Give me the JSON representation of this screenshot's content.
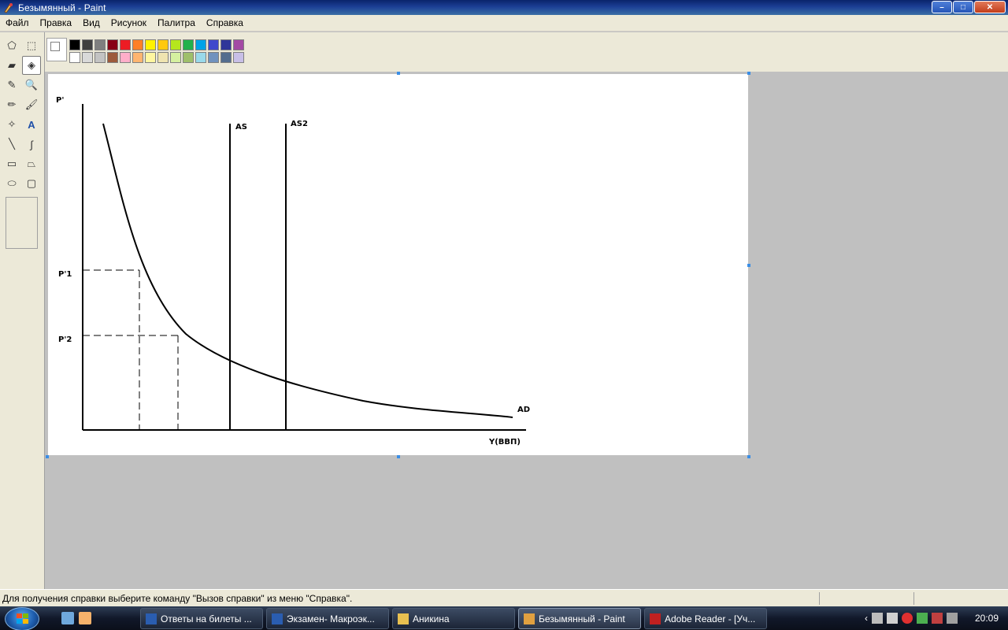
{
  "window": {
    "title": "Безымянный - Paint",
    "buttons": {
      "minimize": "–",
      "maximize": "□",
      "close": "✕"
    }
  },
  "menu": [
    "Файл",
    "Правка",
    "Вид",
    "Рисунок",
    "Палитра",
    "Справка"
  ],
  "tools": [
    {
      "name": "free-select-icon",
      "glyph": "⬠"
    },
    {
      "name": "rect-select-icon",
      "glyph": "⬚"
    },
    {
      "name": "eraser-icon",
      "glyph": "▰"
    },
    {
      "name": "fill-icon",
      "glyph": "◈",
      "selected": true
    },
    {
      "name": "color-picker-icon",
      "glyph": "✎"
    },
    {
      "name": "magnifier-icon",
      "glyph": "🔍"
    },
    {
      "name": "pencil-icon",
      "glyph": "✏"
    },
    {
      "name": "brush-icon",
      "glyph": "🖌"
    },
    {
      "name": "airbrush-icon",
      "glyph": "✧"
    },
    {
      "name": "text-icon",
      "glyph": "A"
    },
    {
      "name": "line-icon",
      "glyph": "╲"
    },
    {
      "name": "curve-icon",
      "glyph": "∫"
    },
    {
      "name": "rectangle-icon",
      "glyph": "▭"
    },
    {
      "name": "polygon-icon",
      "glyph": "⏢"
    },
    {
      "name": "ellipse-icon",
      "glyph": "⬭"
    },
    {
      "name": "rounded-rect-icon",
      "glyph": "▢"
    }
  ],
  "palette": {
    "top": [
      "#000000",
      "#3f3f3f",
      "#7f7f7f",
      "#880015",
      "#ed1c24",
      "#ff7f27",
      "#fff200",
      "#ffc90e",
      "#b5e61d",
      "#22b14c",
      "#00a2e8",
      "#3f48cc",
      "#2f3699",
      "#a349a4"
    ],
    "bottom": [
      "#ffffff",
      "#d9d9d9",
      "#c3c3c3",
      "#9c5a3c",
      "#ffaec9",
      "#ffb570",
      "#fff6a0",
      "#efe4b0",
      "#d5f0a0",
      "#9fbf6b",
      "#99d9ea",
      "#7092be",
      "#546d8e",
      "#c8bfe7"
    ]
  },
  "drawing": {
    "labels": {
      "y_axis": "P'",
      "p1": "P'1",
      "p2": "P'2",
      "as": "AS",
      "as2": "AS2",
      "ad": "AD",
      "x_axis": "Y(ВВП)"
    }
  },
  "status": {
    "help_text": "Для получения справки выберите команду \"Вызов справки\" из меню \"Справка\"."
  },
  "taskbar": {
    "tasks": [
      {
        "label": "Ответы на билеты ...",
        "icon": "word-icon",
        "active": false
      },
      {
        "label": "Экзамен- Макроэк...",
        "icon": "word-icon",
        "active": false
      },
      {
        "label": "Аникина",
        "icon": "folder-icon",
        "active": false
      },
      {
        "label": "Безымянный - Paint",
        "icon": "paint-icon",
        "active": true
      },
      {
        "label": "Adobe Reader - [Уч...",
        "icon": "adobe-icon",
        "active": false
      }
    ],
    "clock": "20:09"
  }
}
